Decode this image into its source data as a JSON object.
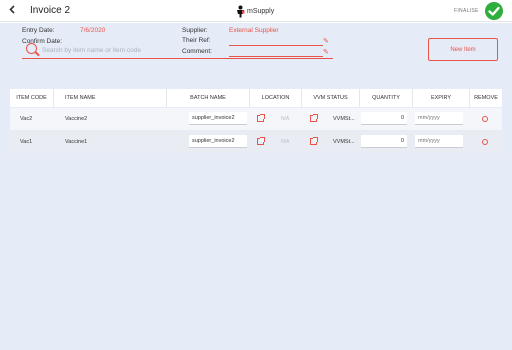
{
  "header": {
    "back_icon": "chevron-left-icon",
    "title": "Invoice 2",
    "logo_text": "mSupply",
    "finalise_label": "FINALISE",
    "confirm_icon": "check-circle-icon",
    "accent_color": "#e8544a",
    "confirm_color": "#2eae3c"
  },
  "details": {
    "entry_date_label": "Entry Date:",
    "entry_date_value": "7/6/2020",
    "confirm_date_label": "Confirm Date:",
    "confirm_date_value": "",
    "supplier_label": "Supplier:",
    "supplier_value": "External Supplier",
    "their_ref_label": "Their Ref:",
    "their_ref_value": "",
    "comment_label": "Comment:",
    "comment_value": ""
  },
  "search": {
    "placeholder": "Search by item name or item code",
    "value": ""
  },
  "new_item_label": "New Item",
  "table": {
    "columns": [
      "ITEM CODE",
      "ITEM NAME",
      "BATCH NAME",
      "LOCATION",
      "VVM STATUS",
      "QUANTITY",
      "EXPIRY",
      "REMOVE"
    ],
    "rows": [
      {
        "item_code": "Vac2",
        "item_name": "Vaccine2",
        "batch_name": "supplier_invoice2",
        "location": "N/A",
        "vvm_status": "VVMSt...",
        "quantity": "0",
        "expiry_placeholder": "mm/yyyy"
      },
      {
        "item_code": "Vac1",
        "item_name": "Vaccine1",
        "batch_name": "supplier_invoice2",
        "location": "N/A",
        "vvm_status": "VVMSt...",
        "quantity": "0",
        "expiry_placeholder": "mm/yyyy"
      }
    ]
  }
}
